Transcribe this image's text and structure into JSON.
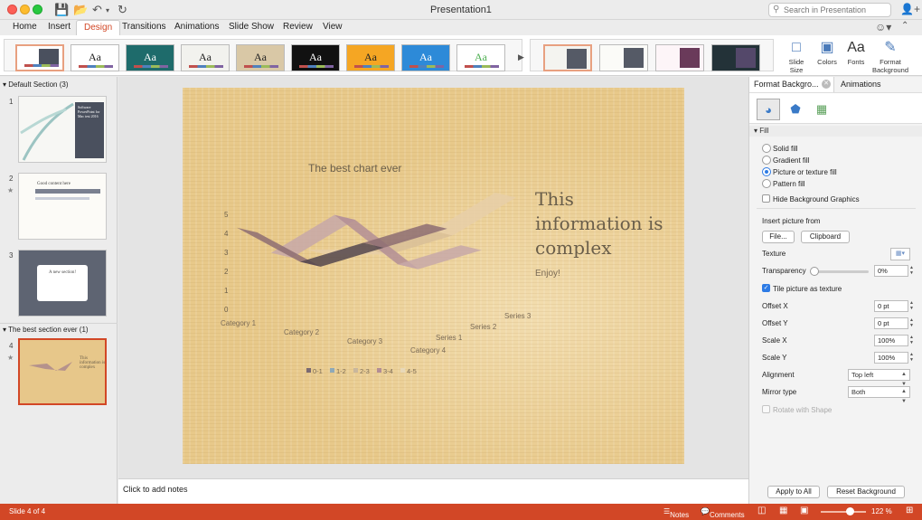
{
  "window": {
    "title": "Presentation1"
  },
  "search": {
    "placeholder": "Search in Presentation"
  },
  "tabs": [
    "Home",
    "Insert",
    "Design",
    "Transitions",
    "Animations",
    "Slide Show",
    "Review",
    "View"
  ],
  "active_tab": "Design",
  "ribbon": {
    "themes": [
      {
        "aa": "",
        "bg": "#ffffff",
        "fg": "#333333"
      },
      {
        "aa": "Aa",
        "bg": "#ffffff",
        "fg": "#222222"
      },
      {
        "aa": "Aa",
        "bg": "#1e6b6b",
        "fg": "#ffffff"
      },
      {
        "aa": "Aa",
        "bg": "#f2f2ee",
        "fg": "#222222"
      },
      {
        "aa": "Aa",
        "bg": "#d9c8a6",
        "fg": "#222222"
      },
      {
        "aa": "Aa",
        "bg": "#111111",
        "fg": "#ffffff"
      },
      {
        "aa": "Aa",
        "bg": "#f5a623",
        "fg": "#222222"
      },
      {
        "aa": "Aa",
        "bg": "#2d8ad8",
        "fg": "#ffffff"
      },
      {
        "aa": "Aa",
        "bg": "#ffffff",
        "fg": "#4caf50"
      }
    ],
    "buttons": {
      "slide_size": "Slide Size",
      "colors": "Colors",
      "fonts": "Fonts",
      "format_background": "Format Background"
    }
  },
  "left_pane": {
    "sections": [
      "Default Section (3)",
      "The best section ever (1)"
    ],
    "slides": [
      {
        "num": "1",
        "text": "Software PowerPoint for Mac test 2016"
      },
      {
        "num": "2",
        "text": "Good content here"
      },
      {
        "num": "3",
        "text": "A new section!"
      },
      {
        "num": "4",
        "text": "This information is complex"
      }
    ]
  },
  "slide": {
    "chart_title": "The best chart ever",
    "heading": "This information is complex",
    "subtitle": "Enjoy!"
  },
  "chart_data": {
    "type": "area",
    "title": "The best chart ever",
    "categories": [
      "Category 1",
      "Category 2",
      "Category 3",
      "Category 4"
    ],
    "series": [
      {
        "name": "Series 1",
        "values": [
          4.3,
          2.5,
          3.5,
          4.5
        ]
      },
      {
        "name": "Series 2",
        "values": [
          2.4,
          4.4,
          1.8,
          2.8
        ]
      },
      {
        "name": "Series 3",
        "values": [
          2.0,
          2.0,
          3.0,
          5.0
        ]
      }
    ],
    "ylim": [
      0,
      5
    ],
    "yticks": [
      "0",
      "1",
      "2",
      "3",
      "4",
      "5"
    ],
    "legend": [
      "0-1",
      "1-2",
      "2-3",
      "3-4",
      "4-5"
    ],
    "legend_colors": [
      "#7a6a72",
      "#8fa9b8",
      "#c9b79c",
      "#b38e95",
      "#e8d8b8"
    ]
  },
  "notes": {
    "placeholder": "Click to add notes"
  },
  "format_panel": {
    "tab1": "Format Backgro...",
    "tab2": "Animations",
    "section": "Fill",
    "fill_options": [
      "Solid fill",
      "Gradient fill",
      "Picture or texture fill",
      "Pattern fill"
    ],
    "selected_fill": "Picture or texture fill",
    "hide_bg": "Hide Background Graphics",
    "insert_from": "Insert picture from",
    "file_btn": "File...",
    "clipboard_btn": "Clipboard",
    "texture_label": "Texture",
    "transparency_label": "Transparency",
    "transparency_value": "0%",
    "tile_label": "Tile picture as texture",
    "offset_x_label": "Offset X",
    "offset_x": "0 pt",
    "offset_y_label": "Offset Y",
    "offset_y": "0 pt",
    "scale_x_label": "Scale X",
    "scale_x": "100%",
    "scale_y_label": "Scale Y",
    "scale_y": "100%",
    "alignment_label": "Alignment",
    "alignment": "Top left",
    "mirror_label": "Mirror type",
    "mirror": "Both",
    "rotate_label": "Rotate with Shape",
    "apply_all": "Apply to All",
    "reset": "Reset Background"
  },
  "status": {
    "slide_of": "Slide 4 of 4",
    "notes": "Notes",
    "comments": "Comments",
    "zoom": "122 %"
  },
  "colors": {
    "accent": "#d24726",
    "link": "#2d7be5"
  }
}
